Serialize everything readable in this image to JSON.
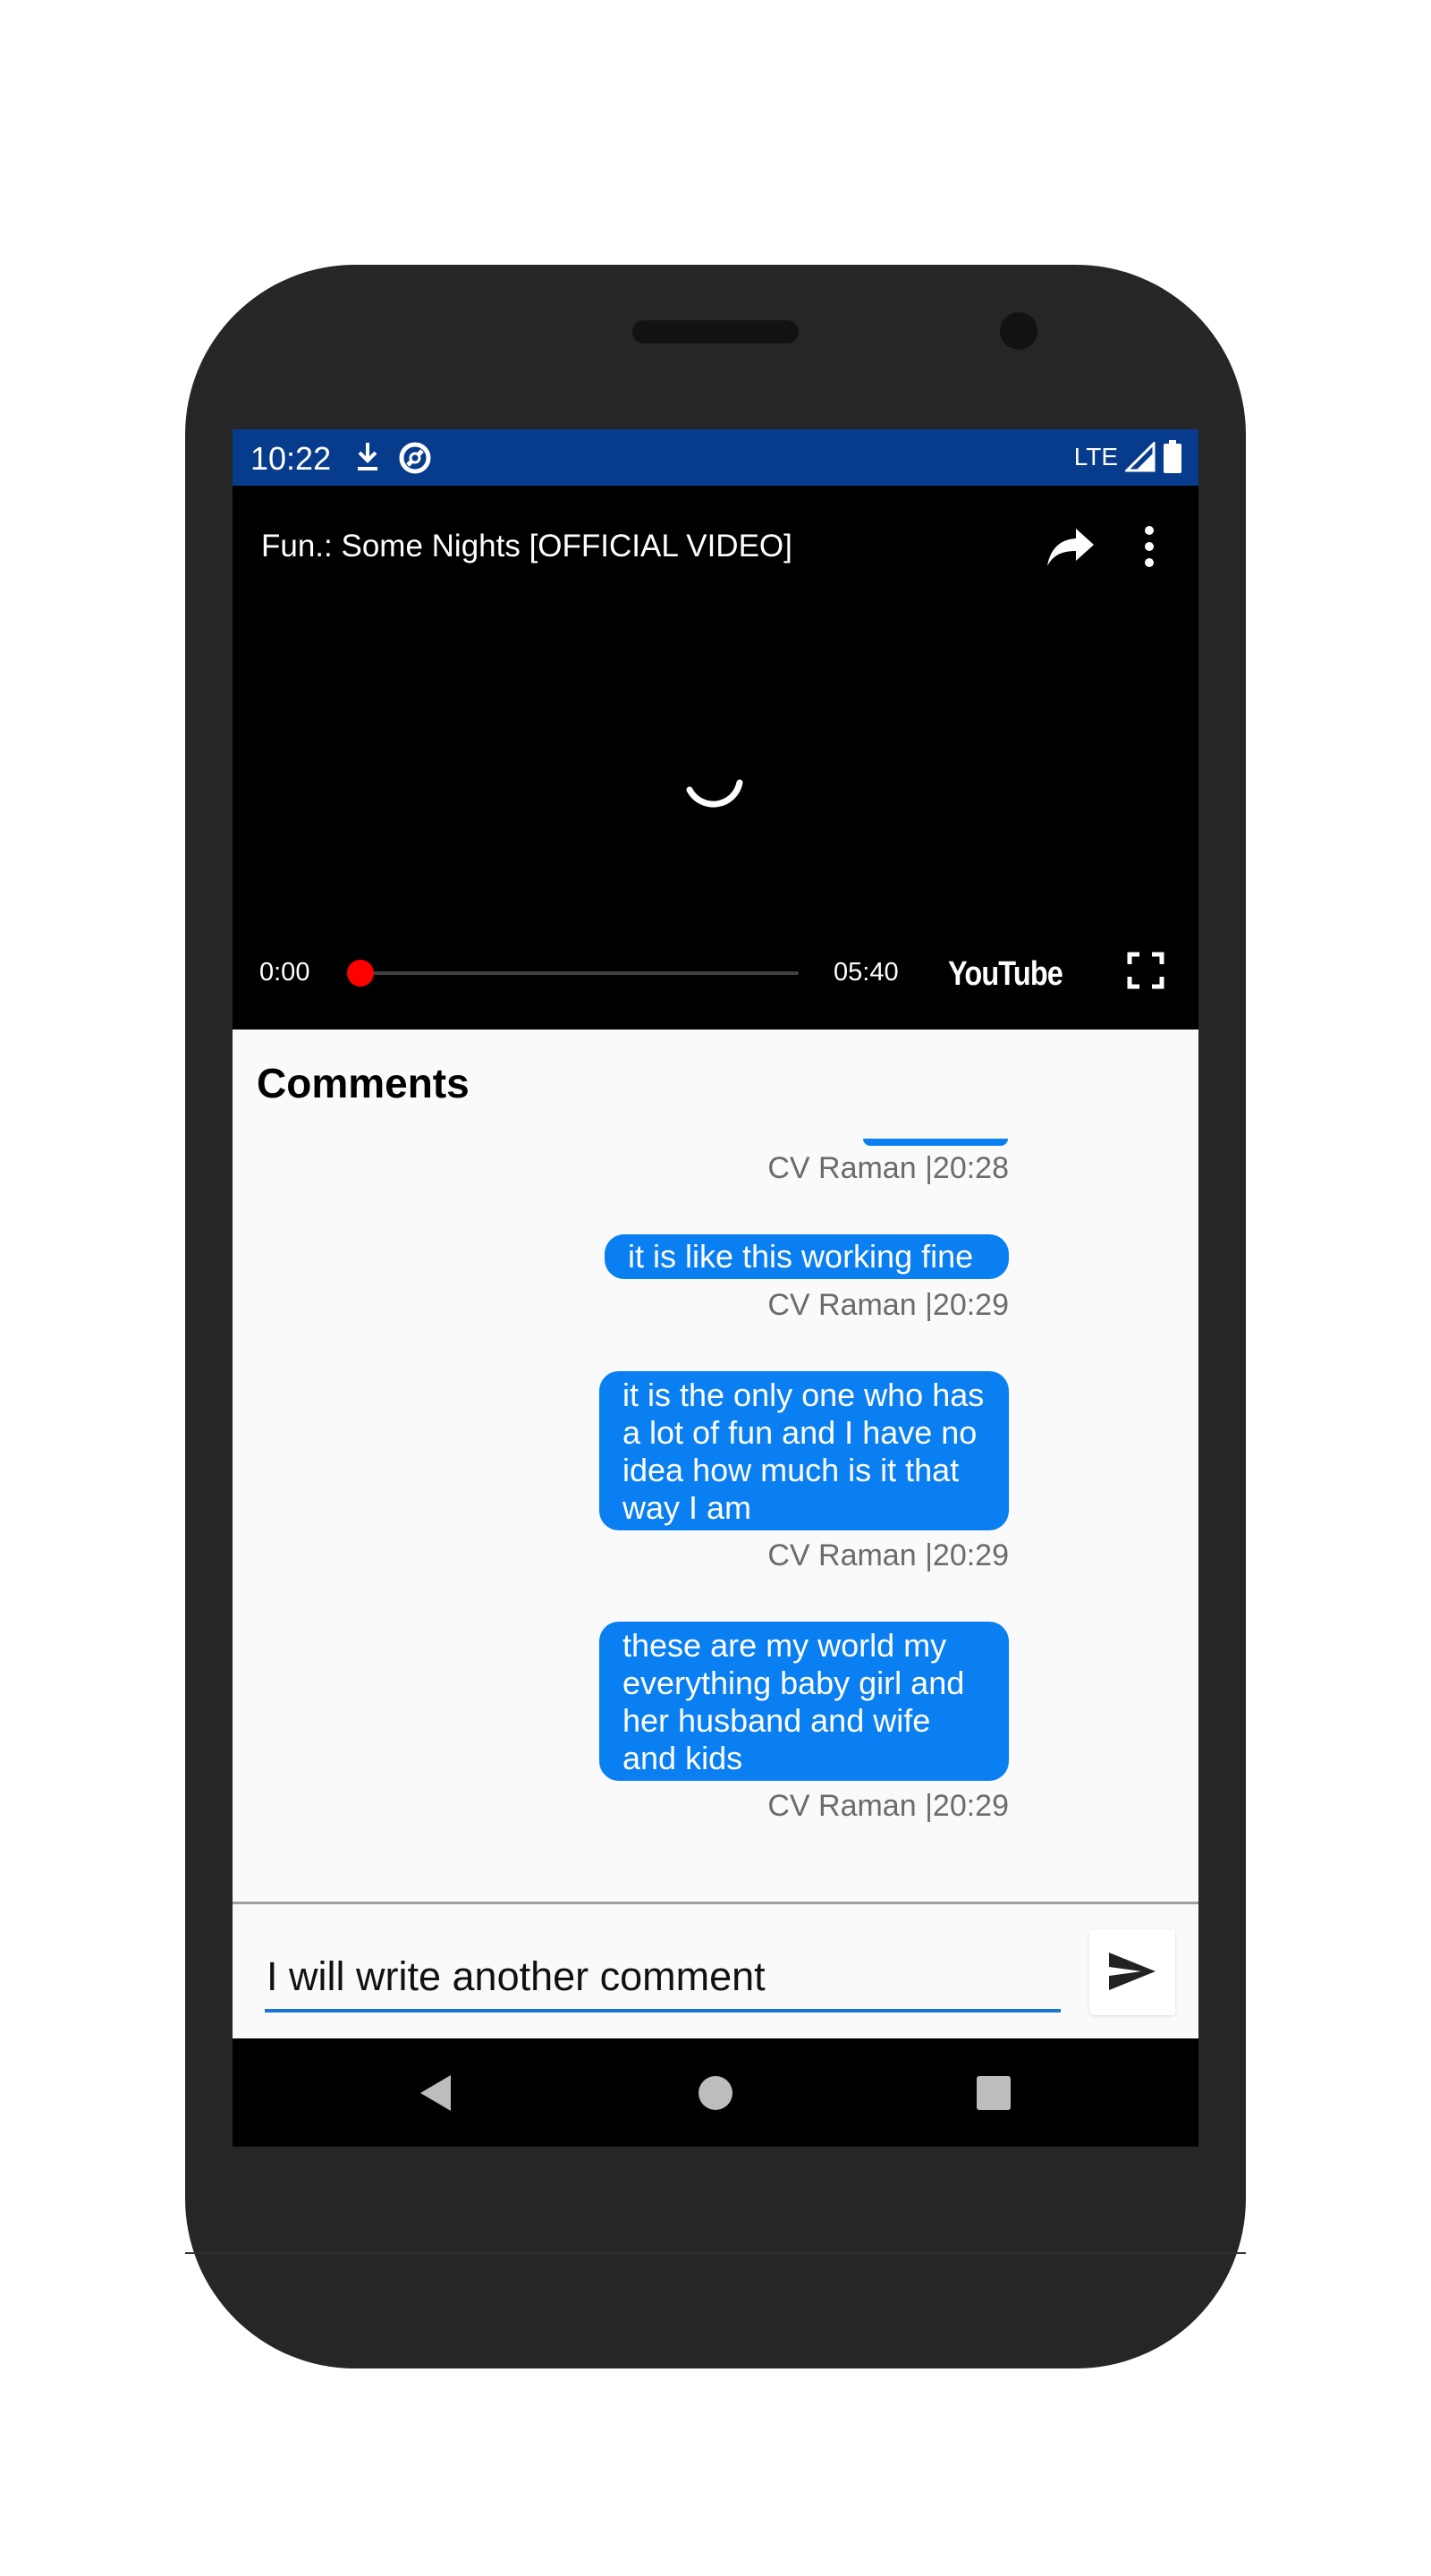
{
  "status_bar": {
    "time": "10:22",
    "network": "LTE",
    "icons": [
      "download-icon",
      "sync-icon",
      "signal-icon",
      "battery-icon"
    ]
  },
  "video": {
    "title": "Fun.: Some Nights [OFFICIAL VIDEO]",
    "current_time": "0:00",
    "duration": "05:40",
    "progress": 0,
    "brand": "YouTube",
    "icons": [
      "share-icon",
      "more-vert-icon",
      "loading-spinner-icon",
      "fullscreen-icon"
    ]
  },
  "comments": {
    "title": "Comments",
    "items": [
      {
        "text": "",
        "meta": "CV Raman |20:28"
      },
      {
        "text": "it is like this working fine",
        "meta": "CV Raman |20:29"
      },
      {
        "text": "it is the only one who has a lot of fun and I have no idea how much is it that way I am",
        "meta": "CV Raman |20:29"
      },
      {
        "text": "these are my world my everything baby girl and her husband and wife and kids",
        "meta": "CV Raman |20:29"
      }
    ]
  },
  "composer": {
    "value": "I will write another comment",
    "send_icon": "send-icon"
  },
  "nav_bar": {
    "icons": [
      "back-icon",
      "home-icon",
      "recents-icon"
    ]
  },
  "colors": {
    "status_bar": "#073b8c",
    "bubble": "#0a7ff2",
    "accent": "#1976d2",
    "seek_thumb": "#ff0000"
  }
}
